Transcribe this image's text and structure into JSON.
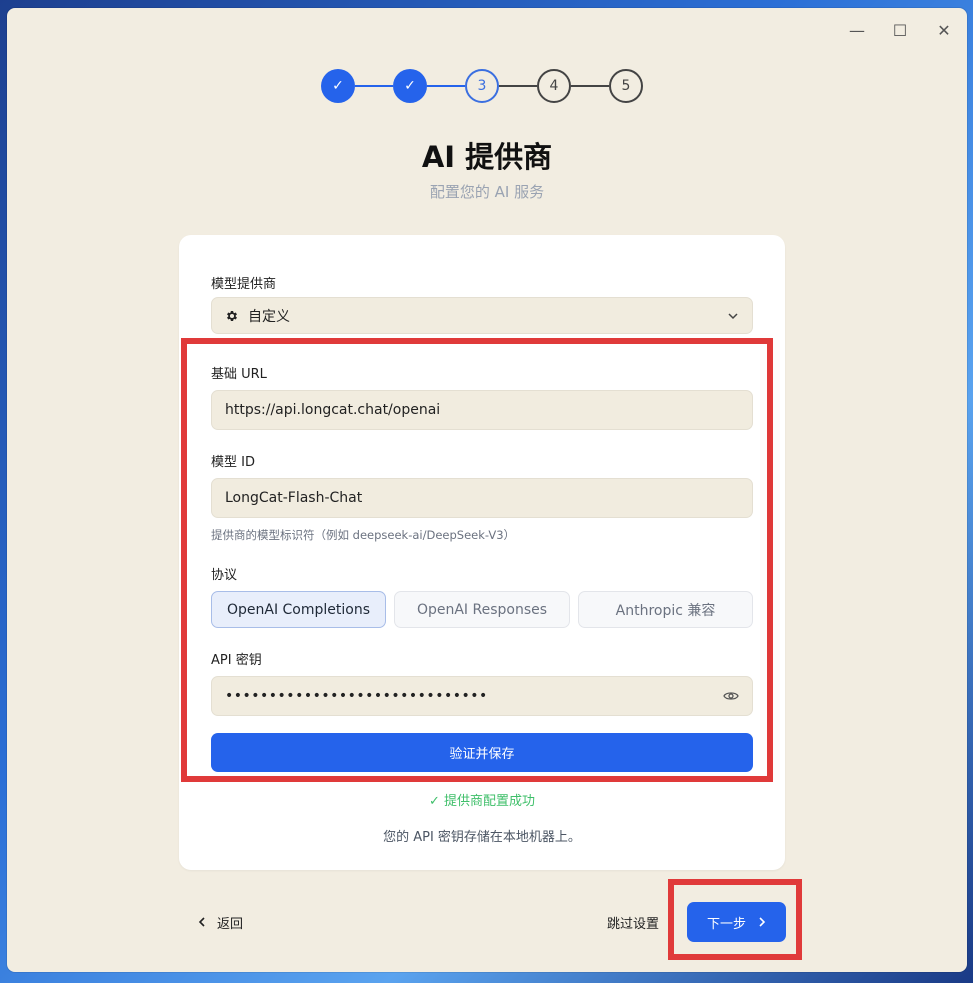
{
  "window": {
    "controls": {
      "minimize": "—",
      "maximize": "☐",
      "close": "✕"
    }
  },
  "stepper": {
    "steps": [
      {
        "label": "✓",
        "state": "done"
      },
      {
        "label": "✓",
        "state": "done"
      },
      {
        "label": "3",
        "state": "active"
      },
      {
        "label": "4",
        "state": "pending"
      },
      {
        "label": "5",
        "state": "pending"
      }
    ]
  },
  "header": {
    "title": "AI 提供商",
    "subtitle": "配置您的 AI 服务"
  },
  "form": {
    "provider_label": "模型提供商",
    "provider_value": "自定义",
    "provider_icon": "gear-icon",
    "base_url_label": "基础 URL",
    "base_url_value": "https://api.longcat.chat/openai",
    "model_id_label": "模型 ID",
    "model_id_value": "LongCat-Flash-Chat",
    "model_id_hint": "提供商的模型标识符（例如 deepseek-ai/DeepSeek-V3）",
    "protocol_label": "协议",
    "protocols": [
      {
        "label": "OpenAI Completions",
        "selected": true
      },
      {
        "label": "OpenAI Responses",
        "selected": false
      },
      {
        "label": "Anthropic 兼容",
        "selected": false
      }
    ],
    "api_key_label": "API 密钥",
    "api_key_value": "••••••••••••••••••••••••••••••",
    "verify_button": "验证并保存",
    "success_message": "✓ 提供商配置成功",
    "storage_note": "您的 API 密钥存储在本地机器上。"
  },
  "footer": {
    "back_label": "返回",
    "skip_label": "跳过设置",
    "next_label": "下一步"
  },
  "colors": {
    "accent": "#2563eb",
    "success": "#3fbf6a",
    "highlight": "#e03a3a",
    "background": "#f2ede1"
  }
}
